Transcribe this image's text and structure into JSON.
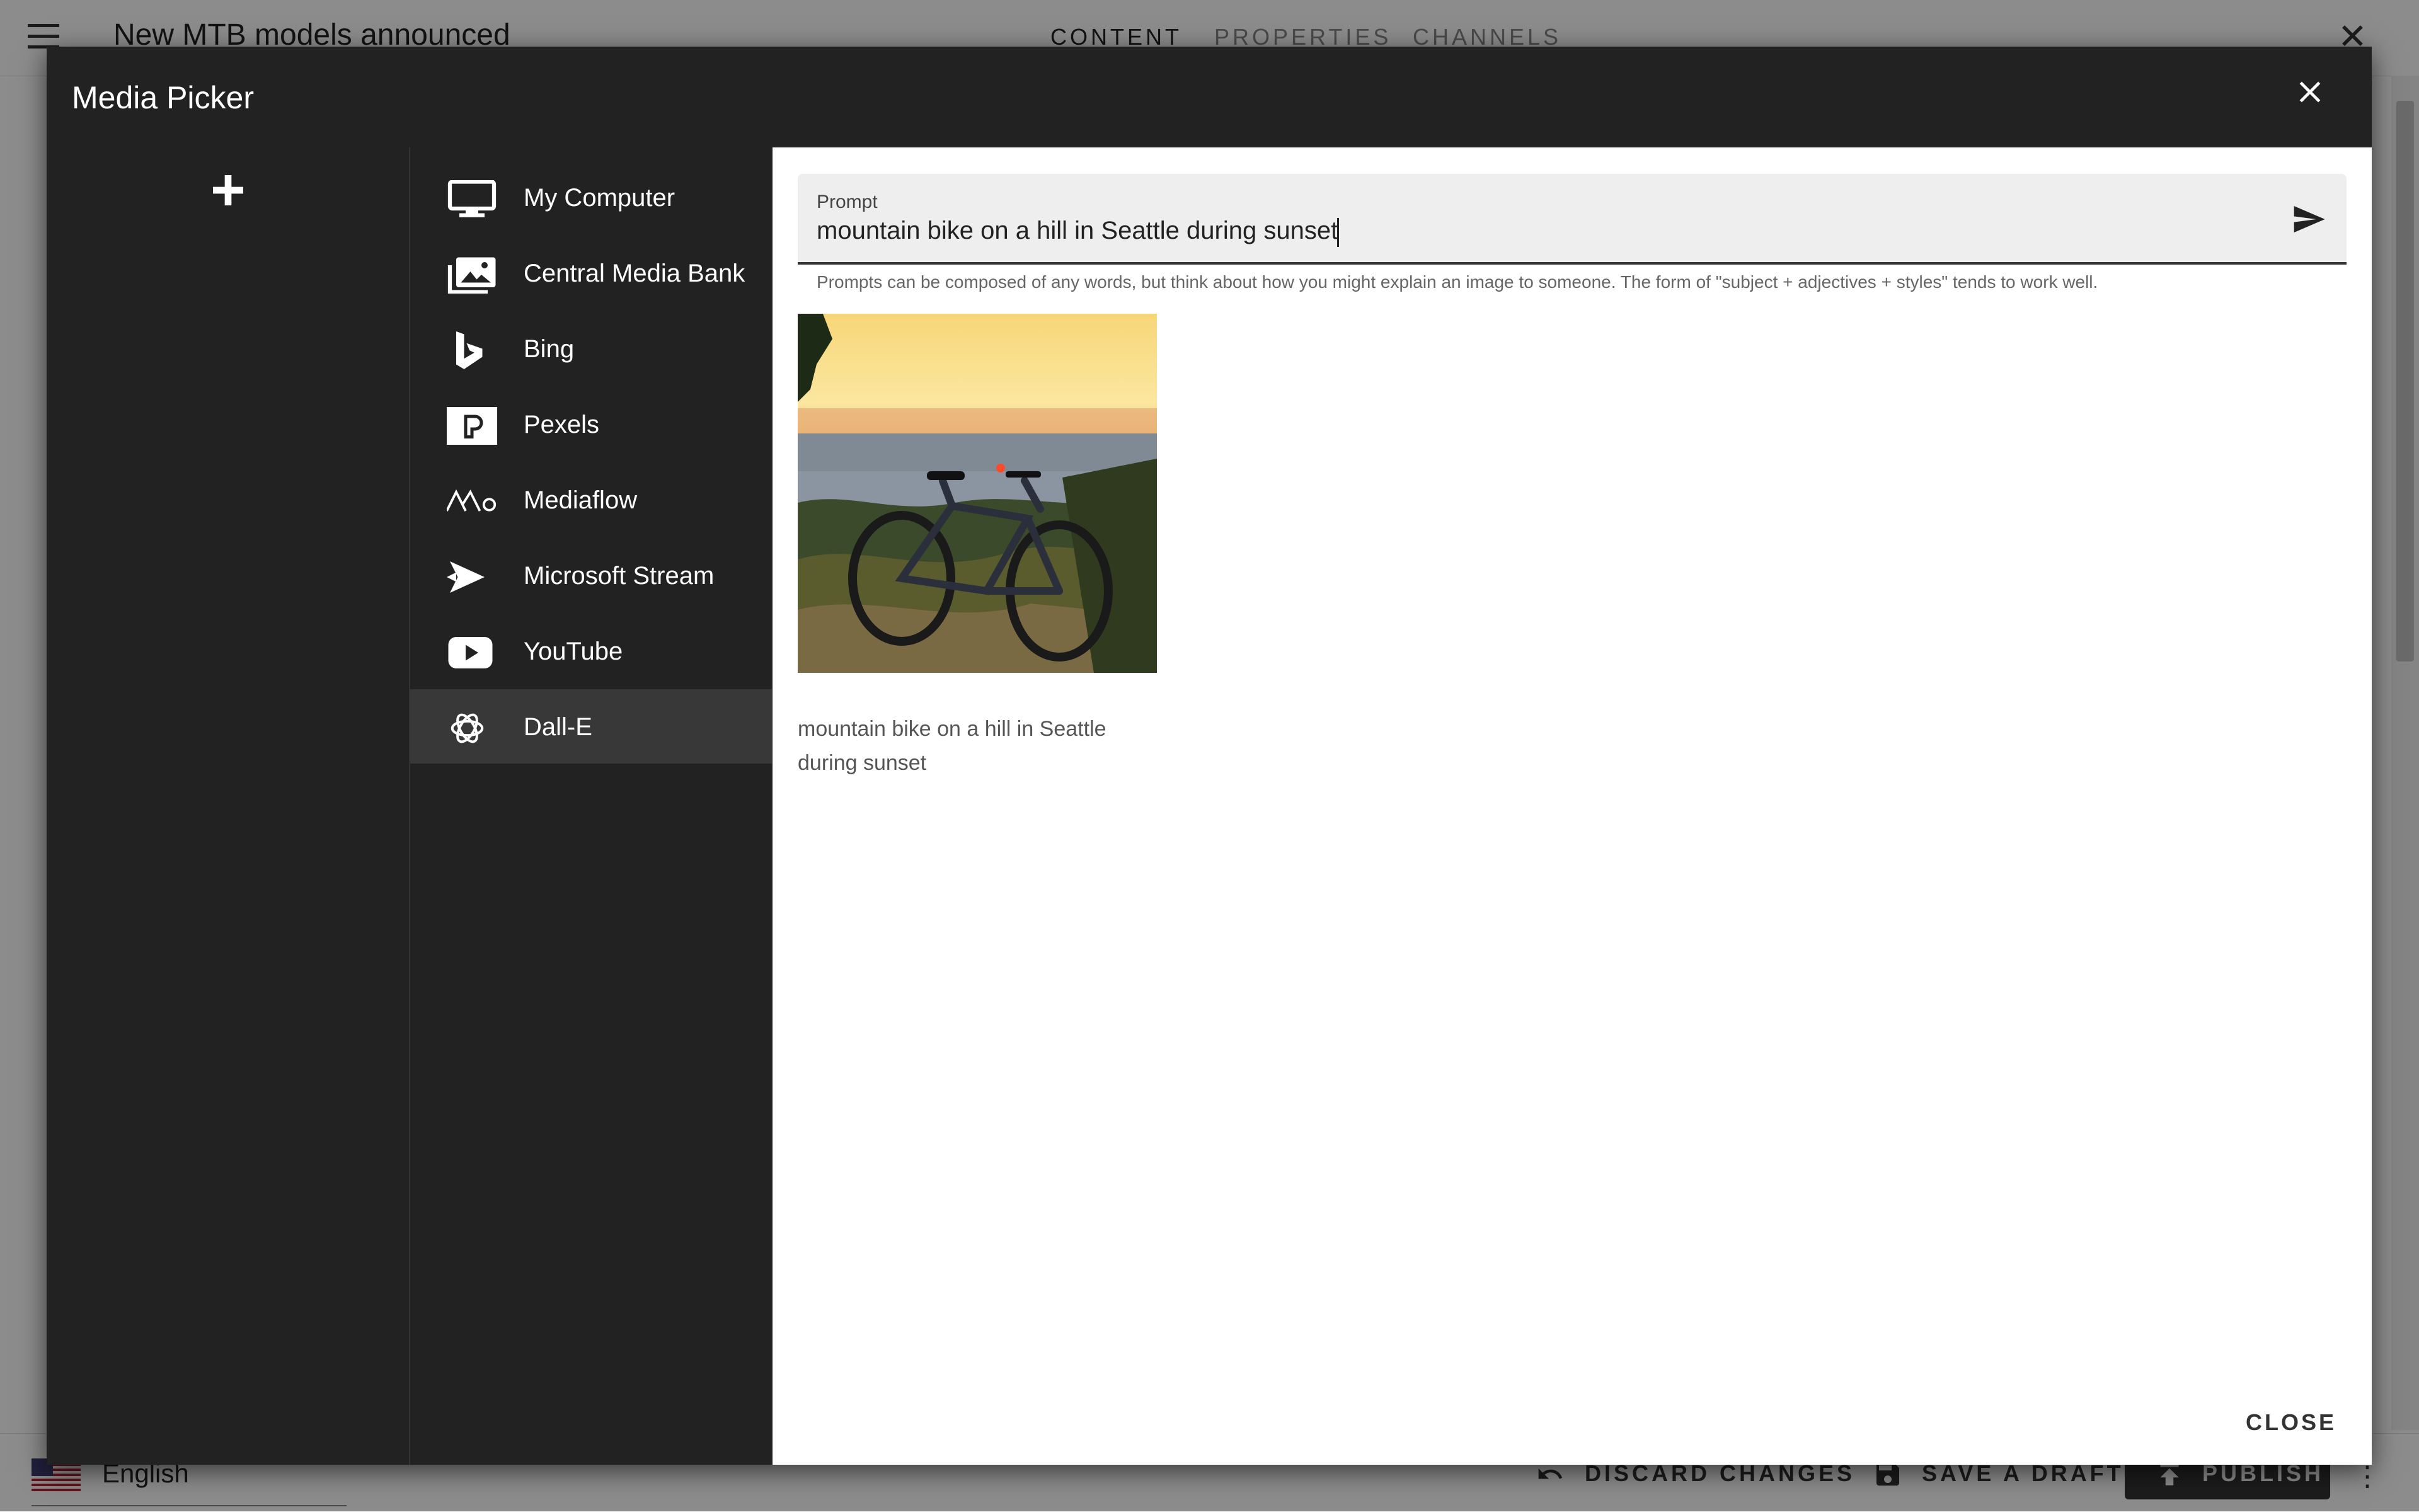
{
  "background": {
    "title": "New MTB models announced",
    "tabs": [
      "CONTENT",
      "PROPERTIES",
      "CHANNELS"
    ],
    "language": "English",
    "discard_label": "DISCARD CHANGES",
    "save_draft_label": "SAVE A DRAFT",
    "publish_label": "PUBLISH"
  },
  "modal": {
    "title": "Media Picker",
    "sources": [
      {
        "label": "My Computer",
        "icon": "monitor-icon"
      },
      {
        "label": "Central Media Bank",
        "icon": "media-bank-icon"
      },
      {
        "label": "Bing",
        "icon": "bing-icon"
      },
      {
        "label": "Pexels",
        "icon": "pexels-icon"
      },
      {
        "label": "Mediaflow",
        "icon": "mediaflow-icon"
      },
      {
        "label": "Microsoft Stream",
        "icon": "stream-icon"
      },
      {
        "label": "YouTube",
        "icon": "youtube-icon"
      },
      {
        "label": "Dall-E",
        "icon": "openai-icon",
        "active": true
      }
    ],
    "prompt": {
      "label": "Prompt",
      "value": "mountain bike on a hill in Seattle during sunset",
      "helper": "Prompts can be composed of any words, but think about how you might explain an image to someone. The form of \"subject + adjectives + styles\" tends to work well."
    },
    "results": [
      {
        "caption": "mountain bike on a hill in Seattle during sunset"
      }
    ],
    "close_label": "CLOSE"
  },
  "colors": {
    "modal_bg": "#222222",
    "active_source_bg": "#383838",
    "content_bg": "#ffffff"
  }
}
